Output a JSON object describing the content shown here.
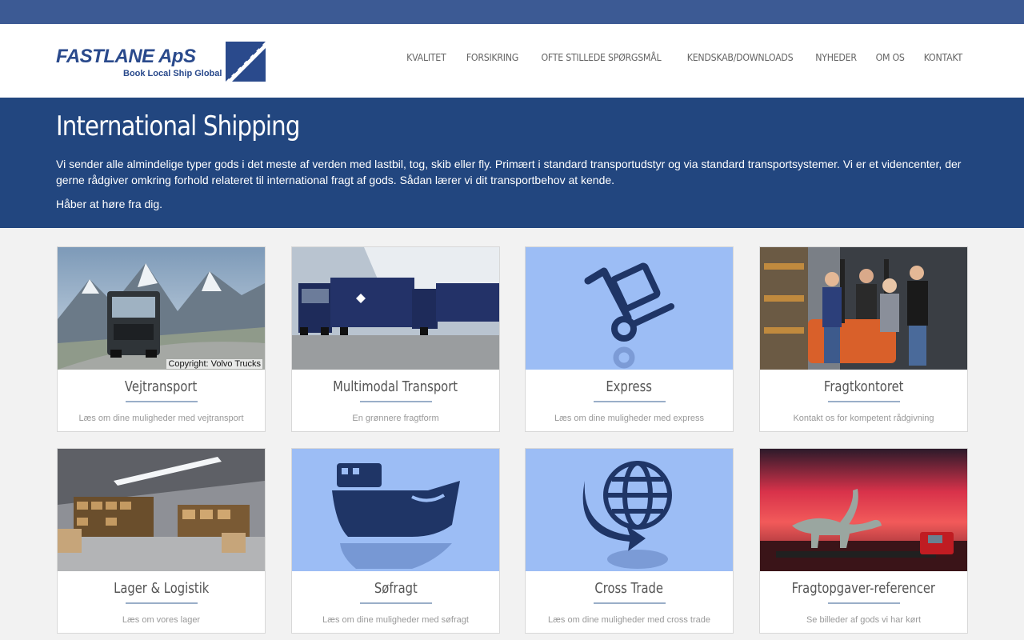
{
  "brand": {
    "name": "FASTLANE ApS",
    "tagline": "Book Local Ship Global",
    "primary_color": "#22467f",
    "topbar_color": "#3c5a94"
  },
  "nav": {
    "items": [
      "KVALITET",
      "FORSIKRING",
      "OFTE STILLEDE SPØRGSMÅL",
      "KENDSKAB/DOWNLOADS",
      "NYHEDER",
      "OM OS",
      "KONTAKT"
    ]
  },
  "hero": {
    "title": "International Shipping",
    "paragraph1": "Vi sender alle almindelige typer gods i det meste af verden med lastbil, tog, skib eller fly. Primært i standard transportudstyr og via standard transportsystemer. Vi er et videncenter, der gerne rådgiver omkring forhold relateret til international fragt af gods. Sådan lærer vi dit transportbehov at kende.",
    "paragraph2": "Håber at høre fra dig."
  },
  "cards": [
    {
      "title": "Vejtransport",
      "desc": "Læs om dine muligheder med vejtransport",
      "image": "truck-mountain-photo",
      "caption": "Copyright: Volvo Trucks"
    },
    {
      "title": "Multimodal Transport",
      "desc": "En grønnere fragtform",
      "image": "dfds-trucks-photo"
    },
    {
      "title": "Express",
      "desc": "Læs om dine muligheder med express",
      "image": "hand-truck-icon"
    },
    {
      "title": "Fragtkontoret",
      "desc": "Kontakt os for kompetent rådgivning",
      "image": "team-forklift-photo"
    },
    {
      "title": "Lager & Logistik",
      "desc": "Læs om vores lager",
      "image": "warehouse-photo"
    },
    {
      "title": "Søfragt",
      "desc": "Læs om dine muligheder med søfragt",
      "image": "ship-icon"
    },
    {
      "title": "Cross Trade",
      "desc": "Læs om dine muligheder med cross trade",
      "image": "globe-arrow-icon"
    },
    {
      "title": "Fragtopgaver-referencer",
      "desc": "Se billeder af gods vi har kørt",
      "image": "dinosaur-truck-photo"
    }
  ]
}
